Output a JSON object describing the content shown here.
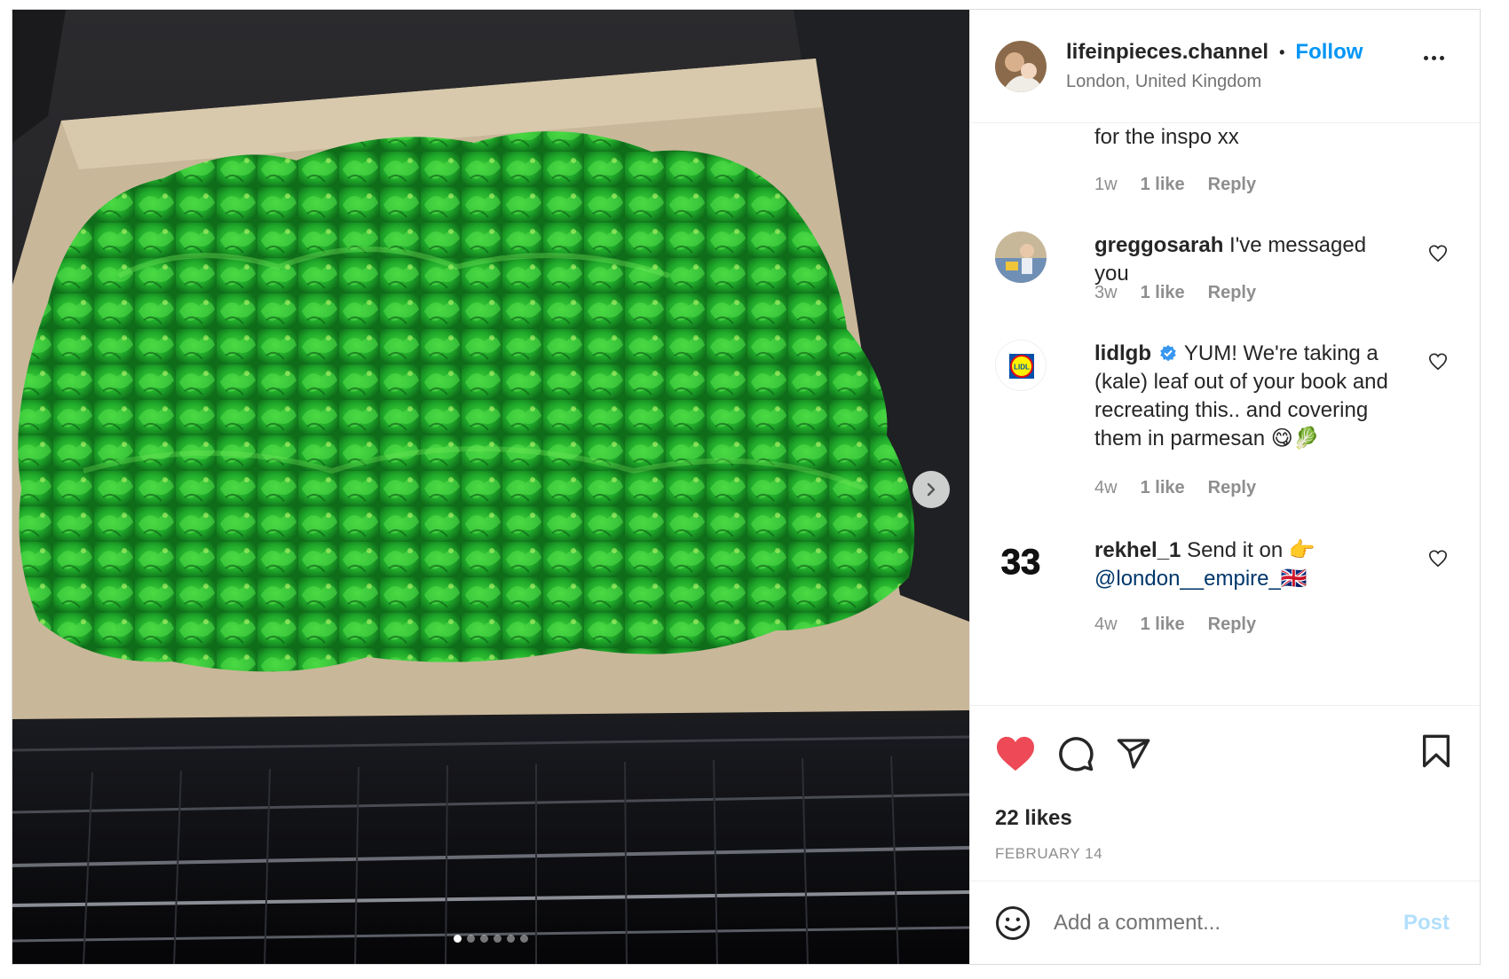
{
  "post": {
    "username": "lifeinpieces.channel",
    "separator": "•",
    "follow_label": "Follow",
    "location": "London, United Kingdom",
    "carousel": {
      "count": 6,
      "active_index": 0
    }
  },
  "comments": [
    {
      "id": "partial",
      "text": "for the inspo xx",
      "time": "1w",
      "likes": "1 like",
      "reply": "Reply"
    },
    {
      "id": "greggosarah",
      "username": "greggosarah",
      "text": "I've messaged you",
      "time": "3w",
      "likes": "1 like",
      "reply": "Reply"
    },
    {
      "id": "lidlgb",
      "username": "lidlgb",
      "verified": true,
      "text": "YUM! We're taking a (kale) leaf out of your book and recreating this.. and covering them in parmesan 😋🥬",
      "time": "4w",
      "likes": "1 like",
      "reply": "Reply",
      "avatar_text": "LIDL"
    },
    {
      "id": "rekhel",
      "username": "rekhel_1",
      "text": "Send it on 👉",
      "mention": "@london__empire_",
      "flag": "🇬🇧",
      "time": "4w",
      "likes": "1 like",
      "reply": "Reply",
      "avatar_text": "33"
    }
  ],
  "likes_text": "22 likes",
  "date_text": "FEBRUARY 14",
  "add_comment": {
    "placeholder": "Add a comment...",
    "post_label": "Post"
  },
  "colors": {
    "accent": "#0095f6",
    "like_red": "#ed4956",
    "mention": "#00376b",
    "post_disabled": "#b2dffc"
  }
}
